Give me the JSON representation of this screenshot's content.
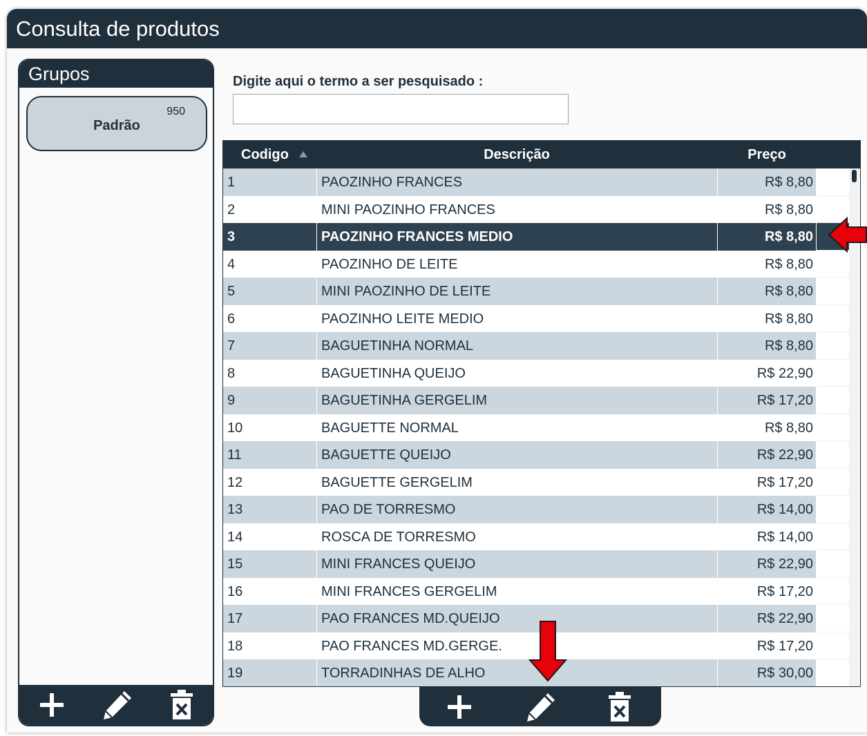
{
  "window": {
    "title": "Consulta de produtos"
  },
  "groups": {
    "title": "Grupos",
    "items": [
      {
        "name": "Padrão",
        "count": "950"
      }
    ],
    "toolbar": {
      "add_icon": "plus-icon",
      "edit_icon": "pencil-icon",
      "delete_icon": "trash-icon"
    }
  },
  "search": {
    "label": "Digite aqui o termo a ser pesquisado :",
    "value": "",
    "placeholder": ""
  },
  "grid": {
    "columns": {
      "codigo": "Codigo",
      "descricao": "Descrição",
      "preco": "Preço"
    },
    "sort": {
      "column": "Codigo",
      "direction": "ascending"
    },
    "selected_row": 3,
    "rows": [
      {
        "codigo": "1",
        "descricao": "PAOZINHO FRANCES",
        "preco": "R$ 8,80"
      },
      {
        "codigo": "2",
        "descricao": "MINI PAOZINHO FRANCES",
        "preco": "R$ 8,80"
      },
      {
        "codigo": "3",
        "descricao": "PAOZINHO FRANCES MEDIO",
        "preco": "R$ 8,80"
      },
      {
        "codigo": "4",
        "descricao": "PAOZINHO DE LEITE",
        "preco": "R$ 8,80"
      },
      {
        "codigo": "5",
        "descricao": "MINI PAOZINHO DE LEITE",
        "preco": "R$ 8,80"
      },
      {
        "codigo": "6",
        "descricao": "PAOZINHO LEITE MEDIO",
        "preco": "R$ 8,80"
      },
      {
        "codigo": "7",
        "descricao": "BAGUETINHA NORMAL",
        "preco": "R$ 8,80"
      },
      {
        "codigo": "8",
        "descricao": "BAGUETINHA QUEIJO",
        "preco": "R$ 22,90"
      },
      {
        "codigo": "9",
        "descricao": "BAGUETINHA GERGELIM",
        "preco": "R$ 17,20"
      },
      {
        "codigo": "10",
        "descricao": "BAGUETTE NORMAL",
        "preco": "R$ 8,80"
      },
      {
        "codigo": "11",
        "descricao": "BAGUETTE QUEIJO",
        "preco": "R$ 22,90"
      },
      {
        "codigo": "12",
        "descricao": "BAGUETTE GERGELIM",
        "preco": "R$ 17,20"
      },
      {
        "codigo": "13",
        "descricao": "PAO DE TORRESMO",
        "preco": "R$ 14,00"
      },
      {
        "codigo": "14",
        "descricao": "ROSCA DE TORRESMO",
        "preco": "R$ 14,00"
      },
      {
        "codigo": "15",
        "descricao": "MINI FRANCES QUEIJO",
        "preco": "R$ 22,90"
      },
      {
        "codigo": "16",
        "descricao": "MINI FRANCES GERGELIM",
        "preco": "R$ 17,20"
      },
      {
        "codigo": "17",
        "descricao": "PAO FRANCES MD.QUEIJO",
        "preco": "R$ 22,90"
      },
      {
        "codigo": "18",
        "descricao": "PAO FRANCES MD.GERGE.",
        "preco": "R$ 17,20"
      },
      {
        "codigo": "19",
        "descricao": "TORRADINHAS DE ALHO",
        "preco": "R$ 30,00"
      }
    ],
    "toolbar": {
      "add_icon": "plus-icon",
      "edit_icon": "pencil-icon",
      "delete_icon": "trash-icon"
    }
  },
  "colors": {
    "header": "#1f2f3c",
    "row_alt": "#cbd6de",
    "selected_row": "#2e4150",
    "annotation_arrow": "#e8000b"
  },
  "annotations": [
    "red-arrow-pointing-selected-row",
    "red-arrow-pointing-edit-button"
  ]
}
